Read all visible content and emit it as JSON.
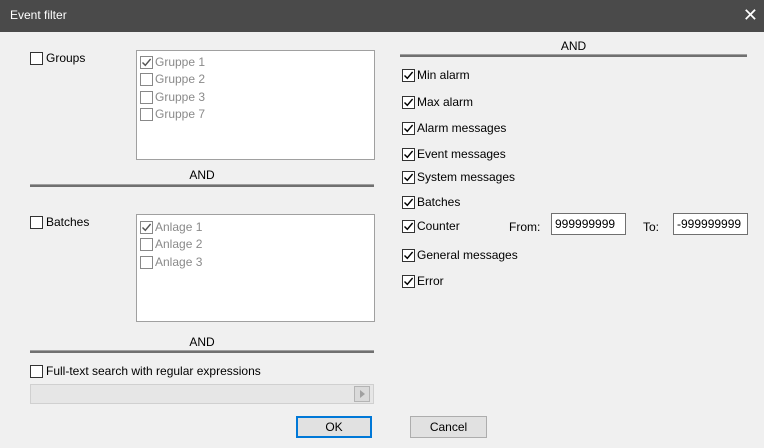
{
  "window": {
    "title": "Event filter",
    "close_glyph": "✕"
  },
  "groups": {
    "label": "Groups",
    "checked": false,
    "items": [
      {
        "label": "Gruppe 1",
        "checked": true
      },
      {
        "label": "Gruppe 2",
        "checked": false
      },
      {
        "label": "Gruppe 3",
        "checked": false
      },
      {
        "label": "Gruppe 7",
        "checked": false
      }
    ]
  },
  "and_labels": {
    "right_top": "AND",
    "left_middle": "AND",
    "left_bottom": "AND"
  },
  "batches": {
    "label": "Batches",
    "checked": false,
    "items": [
      {
        "label": "Anlage 1",
        "checked": true
      },
      {
        "label": "Anlage 2",
        "checked": false
      },
      {
        "label": "Anlage 3",
        "checked": false
      }
    ]
  },
  "fulltext": {
    "label": "Full-text search with regular expressions",
    "checked": false,
    "value": ""
  },
  "options": [
    {
      "label": "Min alarm",
      "checked": true
    },
    {
      "label": "Max alarm",
      "checked": true
    },
    {
      "label": "Alarm messages",
      "checked": true
    },
    {
      "label": "Event messages",
      "checked": true
    },
    {
      "label": "System messages",
      "checked": true
    },
    {
      "label": "Batches",
      "checked": true
    },
    {
      "label": "Counter",
      "checked": true
    },
    {
      "label": "General messages",
      "checked": true
    },
    {
      "label": "Error",
      "checked": true
    }
  ],
  "counter": {
    "from_label": "From:",
    "from_value": "999999999",
    "to_label": "To:",
    "to_value": "-999999999"
  },
  "buttons": {
    "ok": "OK",
    "cancel": "Cancel"
  },
  "colors": {
    "titlebar": "#4a4a4a",
    "background": "#f0f0f0",
    "default_button_border": "#0078d7"
  }
}
